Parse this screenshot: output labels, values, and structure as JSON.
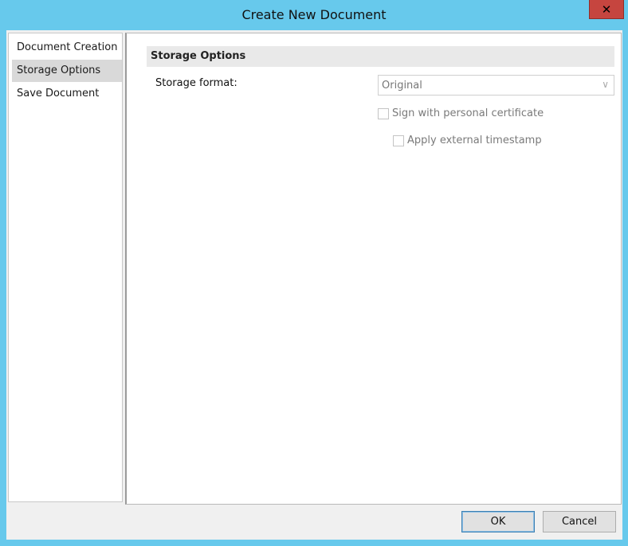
{
  "window": {
    "title": "Create New Document"
  },
  "nav": {
    "items": [
      {
        "label": "Document Creation",
        "selected": false
      },
      {
        "label": "Storage Options",
        "selected": true
      },
      {
        "label": "Save Document",
        "selected": false
      }
    ]
  },
  "section": {
    "title": "Storage Options"
  },
  "storage_format": {
    "label": "Storage format:",
    "value": "Original"
  },
  "options": {
    "sign_label": "Sign with personal certificate",
    "sign_checked": false,
    "timestamp_label": "Apply external timestamp",
    "timestamp_checked": false
  },
  "buttons": {
    "ok": "OK",
    "cancel": "Cancel"
  },
  "icons": {
    "close": "close-icon",
    "dropdown": "chevron-down-icon"
  },
  "colors": {
    "title_bar": "#67c9ec",
    "close_button": "#c6453f"
  }
}
